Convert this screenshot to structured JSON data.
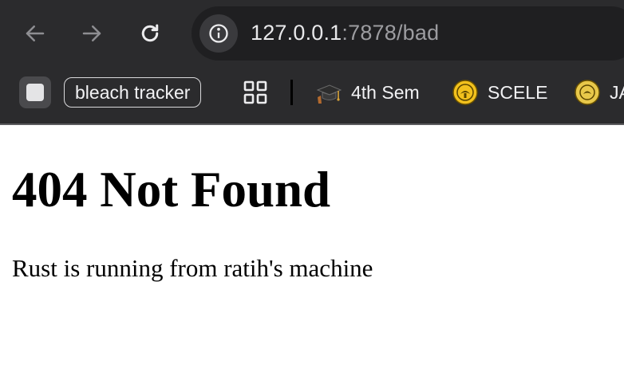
{
  "browser": {
    "url_host": "127.0.0.1",
    "url_rest": ":7878/bad",
    "icons": {
      "back": "arrow-left-icon",
      "forward": "arrow-right-icon",
      "reload": "reload-icon",
      "site_info": "info-icon",
      "apps": "apps-grid-icon"
    },
    "bookmarks": [
      {
        "label": "",
        "icon": "square-icon"
      },
      {
        "label": "bleach tracker"
      },
      {
        "label": "4th Sem",
        "icon": "graduation-cap-icon"
      },
      {
        "label": "SCELE",
        "icon": "university-seal-icon"
      },
      {
        "label": "JA",
        "icon": "university-seal-icon"
      }
    ]
  },
  "page": {
    "heading": "404 Not Found",
    "message": "Rust is running from ratih's machine"
  }
}
